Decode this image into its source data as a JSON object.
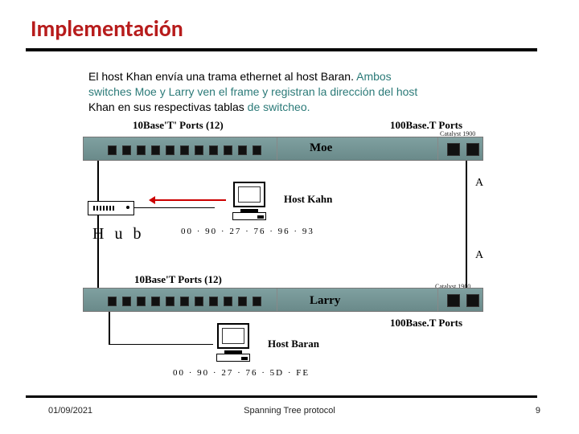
{
  "title": "Implementación",
  "description": {
    "line1_pre": "El host Khan envía una trama ethernet al host Baran.",
    "line1_post": " Ambos",
    "line2a": "switches Moe y Larry ven el frame y registran la dirección del host",
    "line3_pre": "Khan en sus respectivas tablas",
    "line3_post": "  de switcheo."
  },
  "labels": {
    "ports10_top": "10Base'T' Ports  (12)",
    "ports100_top": "100Base.T Ports",
    "ports10_bot": "10Base'T Ports  (12)",
    "ports100_bot": "100Base.T Ports",
    "catalyst_top": "Catalyst 1900",
    "catalyst_bot": "Catalyst 1900",
    "switch_moe": "Moe",
    "switch_larry": "Larry",
    "host_kahn": "Host Kahn",
    "host_baran": "Host Baran",
    "hub": "H u b",
    "mac_kahn": "00 · 90 · 27 · 76 · 96 · 93",
    "mac_baran": "00 · 90 · 27 · 76 · 5D · FE",
    "link_a": "A"
  },
  "footer": {
    "date": "01/09/2021",
    "center": "Spanning Tree protocol",
    "page": "9"
  }
}
